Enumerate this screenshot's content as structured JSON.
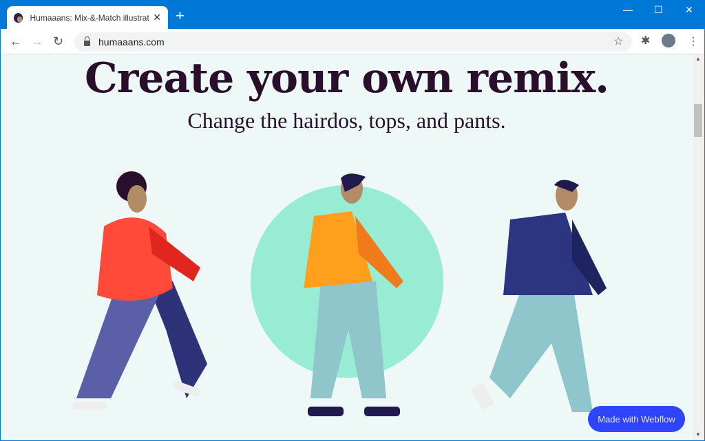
{
  "browser": {
    "tab_title": "Humaaans: Mix-&-Match illustrations",
    "tab_close": "✕",
    "new_tab": "+",
    "url": "humaaans.com",
    "accent": "#0078d7"
  },
  "page": {
    "title": "Create your own remix.",
    "subtitle": "Change the hairdos, tops, and pants.",
    "badge": "Made with Webflow",
    "badge_color": "#2f44ff"
  }
}
